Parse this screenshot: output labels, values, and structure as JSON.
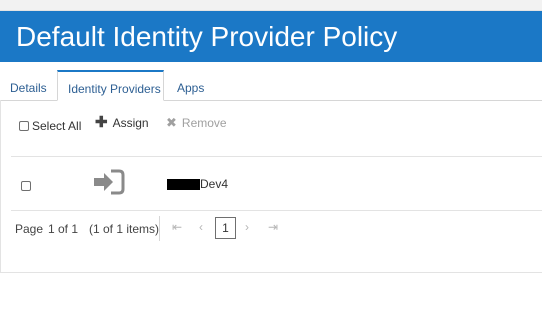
{
  "page": {
    "title": "Default Identity Provider Policy"
  },
  "tabs": [
    {
      "label": "Details"
    },
    {
      "label": "Identity Providers"
    },
    {
      "label": "Apps"
    }
  ],
  "toolbar": {
    "select_all_label": "Select All",
    "assign_label": "Assign",
    "remove_label": "Remove"
  },
  "table": {
    "rows": [
      {
        "name_suffix": "Dev4",
        "icon": "sign-in-icon",
        "name_redacted": true
      }
    ]
  },
  "pager": {
    "page_label": "Page",
    "page_of": "1 of 1",
    "items_summary": "(1 of 1 items)",
    "current_page": "1",
    "first_icon": "first-page-icon",
    "prev_icon": "prev-page-icon",
    "next_icon": "next-page-icon",
    "last_icon": "last-page-icon"
  },
  "colors": {
    "banner": "#1b78c6",
    "tab_text": "#2d5f93",
    "disabled": "#a0a0a0"
  }
}
